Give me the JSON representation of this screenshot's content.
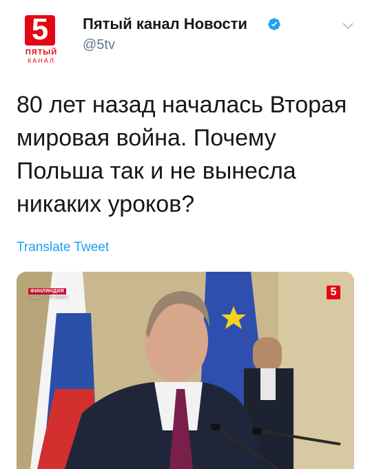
{
  "account": {
    "name": "Пятый канал Новости",
    "handle": "@5tv",
    "avatar": {
      "digit": "5",
      "word1": "ПЯТЫЙ",
      "word2": "КАНАЛ"
    }
  },
  "tweet": {
    "text": "80 лет назад началась Вторая мировая война. Почему Польша так и не вынесла никаких уроков?",
    "translate_label": "Translate Tweet"
  },
  "media": {
    "location_tag": "ФИНЛЯНДИЯ",
    "date_tag": "21 АВГУСТА 2019 Г.",
    "channel_logo": "5"
  },
  "colors": {
    "link": "#1da1f2",
    "verified": "#1da1f2",
    "handle": "#657786",
    "brand_red": "#e30613"
  },
  "icons": {
    "verified": "verified-badge-icon",
    "menu": "chevron-down-icon"
  }
}
